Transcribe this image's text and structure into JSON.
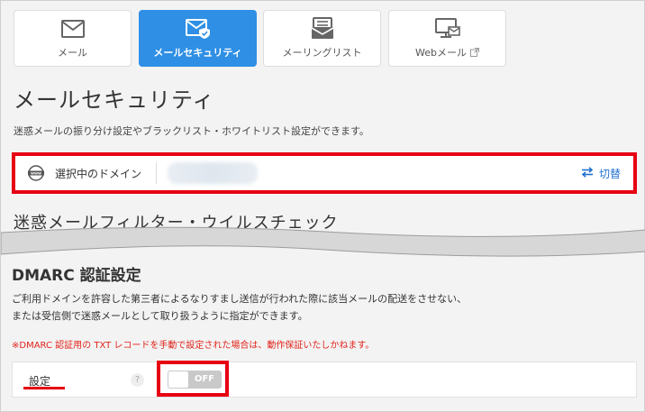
{
  "tabs": [
    {
      "label": "メール",
      "icon": "envelope-icon",
      "active": false
    },
    {
      "label": "メールセキュリティ",
      "icon": "envelope-shield-icon",
      "active": true
    },
    {
      "label": "メーリングリスト",
      "icon": "mailing-list-icon",
      "active": false
    },
    {
      "label": "Webメール",
      "icon": "monitor-mail-icon",
      "active": false
    }
  ],
  "page": {
    "title": "メールセキュリティ",
    "description": "迷惑メールの振り分け設定やブラックリスト・ホワイトリスト設定ができます。"
  },
  "domain": {
    "label": "選択中のドメイン",
    "switch_label": "切替"
  },
  "cut_section": {
    "title": "迷惑メールフィルター・ウイルスチェック"
  },
  "dmarc": {
    "title": "DMARC 認証設定",
    "description_line1": "ご利用ドメインを許容した第三者によるなりすまし送信が行われた際に該当メールの配送をさせない、",
    "description_line2": "または受信側で迷惑メールとして取り扱うように指定ができます。",
    "note": "※DMARC 認証用の TXT レコードを手動で設定された場合は、動作保証いたしかねます。",
    "setting_label": "設定",
    "help_label": "?",
    "toggle_state": "OFF"
  },
  "colors": {
    "accent": "#2e8fe5",
    "highlight": "#e60012",
    "link": "#1f6fd0",
    "note": "#e2231a"
  }
}
